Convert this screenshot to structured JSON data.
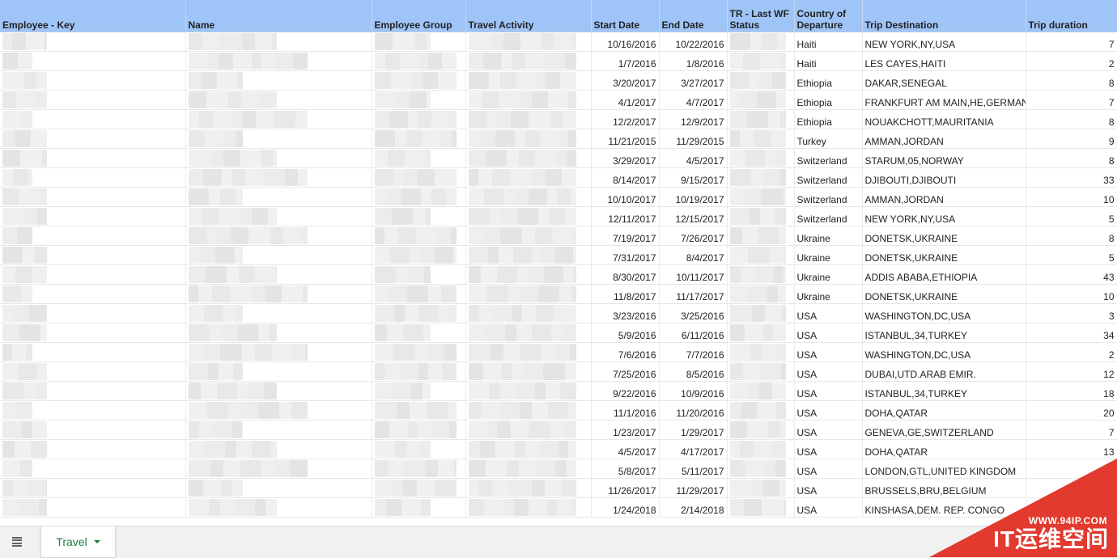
{
  "headers": {
    "employee_key": "Employee - Key",
    "name": "Name",
    "employee_group": "Employee Group",
    "travel_activity": "Travel Activity",
    "start_date": "Start Date",
    "end_date": "End Date",
    "tr_status": "TR - Last WF Status",
    "country_departure": "Country of Departure",
    "trip_destination": "Trip Destination",
    "trip_duration": "Trip duration"
  },
  "rows": [
    {
      "start": "10/16/2016",
      "end": "10/22/2016",
      "country": "Haiti",
      "dest": "NEW YORK,NY,USA",
      "dur": "7"
    },
    {
      "start": "1/7/2016",
      "end": "1/8/2016",
      "country": "Haiti",
      "dest": "LES CAYES,HAITI",
      "dur": "2"
    },
    {
      "start": "3/20/2017",
      "end": "3/27/2017",
      "country": "Ethiopia",
      "dest": "DAKAR,SENEGAL",
      "dur": "8"
    },
    {
      "start": "4/1/2017",
      "end": "4/7/2017",
      "country": "Ethiopia",
      "dest": "FRANKFURT AM MAIN,HE,GERMANY",
      "dur": "7"
    },
    {
      "start": "12/2/2017",
      "end": "12/9/2017",
      "country": "Ethiopia",
      "dest": "NOUAKCHOTT,MAURITANIA",
      "dur": "8"
    },
    {
      "start": "11/21/2015",
      "end": "11/29/2015",
      "country": "Turkey",
      "dest": "AMMAN,JORDAN",
      "dur": "9"
    },
    {
      "start": "3/29/2017",
      "end": "4/5/2017",
      "country": "Switzerland",
      "dest": "STARUM,05,NORWAY",
      "dur": "8"
    },
    {
      "start": "8/14/2017",
      "end": "9/15/2017",
      "country": "Switzerland",
      "dest": "DJIBOUTI,DJIBOUTI",
      "dur": "33"
    },
    {
      "start": "10/10/2017",
      "end": "10/19/2017",
      "country": "Switzerland",
      "dest": "AMMAN,JORDAN",
      "dur": "10"
    },
    {
      "start": "12/11/2017",
      "end": "12/15/2017",
      "country": "Switzerland",
      "dest": "NEW YORK,NY,USA",
      "dur": "5"
    },
    {
      "start": "7/19/2017",
      "end": "7/26/2017",
      "country": "Ukraine",
      "dest": "DONETSK,UKRAINE",
      "dur": "8"
    },
    {
      "start": "7/31/2017",
      "end": "8/4/2017",
      "country": "Ukraine",
      "dest": "DONETSK,UKRAINE",
      "dur": "5"
    },
    {
      "start": "8/30/2017",
      "end": "10/11/2017",
      "country": "Ukraine",
      "dest": "ADDIS ABABA,ETHIOPIA",
      "dur": "43"
    },
    {
      "start": "11/8/2017",
      "end": "11/17/2017",
      "country": "Ukraine",
      "dest": "DONETSK,UKRAINE",
      "dur": "10"
    },
    {
      "start": "3/23/2016",
      "end": "3/25/2016",
      "country": "USA",
      "dest": "WASHINGTON,DC,USA",
      "dur": "3"
    },
    {
      "start": "5/9/2016",
      "end": "6/11/2016",
      "country": "USA",
      "dest": "ISTANBUL,34,TURKEY",
      "dur": "34"
    },
    {
      "start": "7/6/2016",
      "end": "7/7/2016",
      "country": "USA",
      "dest": "WASHINGTON,DC,USA",
      "dur": "2"
    },
    {
      "start": "7/25/2016",
      "end": "8/5/2016",
      "country": "USA",
      "dest": "DUBAI,UTD.ARAB EMIR.",
      "dur": "12"
    },
    {
      "start": "9/22/2016",
      "end": "10/9/2016",
      "country": "USA",
      "dest": "ISTANBUL,34,TURKEY",
      "dur": "18"
    },
    {
      "start": "11/1/2016",
      "end": "11/20/2016",
      "country": "USA",
      "dest": "DOHA,QATAR",
      "dur": "20"
    },
    {
      "start": "1/23/2017",
      "end": "1/29/2017",
      "country": "USA",
      "dest": "GENEVA,GE,SWITZERLAND",
      "dur": "7"
    },
    {
      "start": "4/5/2017",
      "end": "4/17/2017",
      "country": "USA",
      "dest": "DOHA,QATAR",
      "dur": "13"
    },
    {
      "start": "5/8/2017",
      "end": "5/11/2017",
      "country": "USA",
      "dest": "LONDON,GTL,UNITED KINGDOM",
      "dur": ""
    },
    {
      "start": "11/26/2017",
      "end": "11/29/2017",
      "country": "USA",
      "dest": "BRUSSELS,BRU,BELGIUM",
      "dur": ""
    },
    {
      "start": "1/24/2018",
      "end": "2/14/2018",
      "country": "USA",
      "dest": "KINSHASA,DEM. REP. CONGO",
      "dur": ""
    }
  ],
  "sheet_tab": {
    "label": "Travel"
  },
  "watermark": {
    "url": "WWW.94IP.COM",
    "text": "IT运维空间"
  },
  "colors": {
    "header_bg": "#9fc5f8",
    "tab_text": "#188038",
    "watermark_bg": "#e23a2f"
  }
}
